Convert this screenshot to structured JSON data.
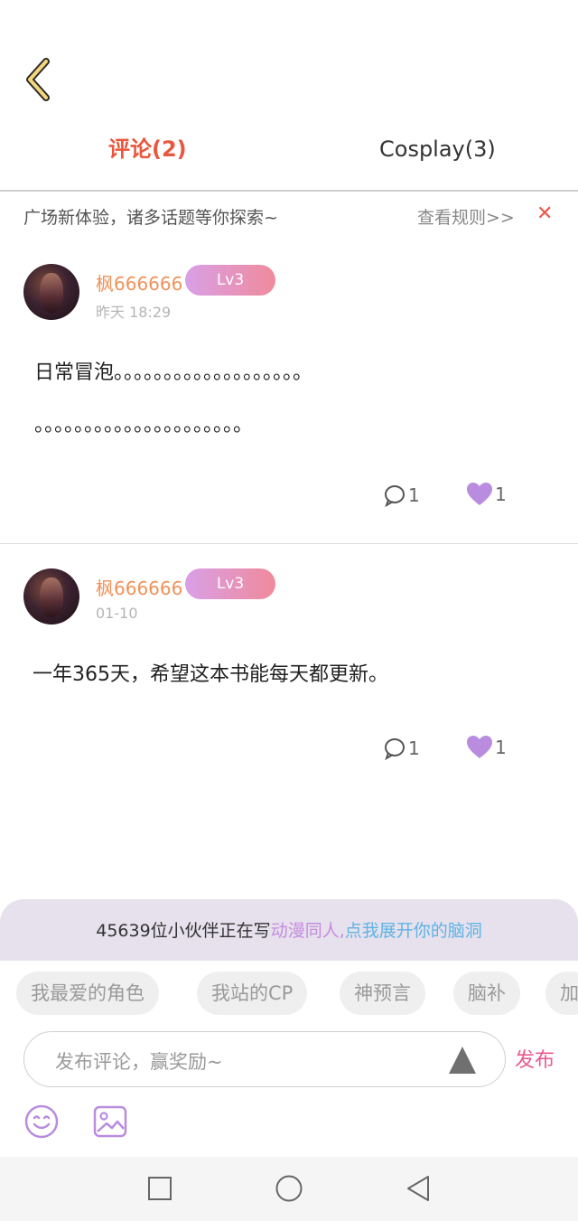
{
  "header": {
    "back_icon": "chevron-left-icon",
    "tabs": [
      {
        "label": "评论(2)",
        "active": true
      },
      {
        "label": "Cosplay(3)",
        "active": false
      }
    ],
    "accent_color": "#e8573e"
  },
  "notice": {
    "text": "广场新体验，诸多话题等你探索~",
    "rules_link": "查看规则>>",
    "close_icon": "close-icon"
  },
  "comments": [
    {
      "username": "枫666666",
      "level": "Lv3",
      "time": "昨天 18:29",
      "body_line1": "日常冒泡。。。。。。。。。。。。。。。。。。。",
      "body_line2": "。。。。。。。。。。。。。。。。。。。。。",
      "reply_count": "1",
      "like_count": "1"
    },
    {
      "username": "枫666666",
      "level": "Lv3",
      "time": "01-10",
      "body_line1": "一年365天，希望这本书能每天都更新。",
      "reply_count": "1",
      "like_count": "1"
    }
  ],
  "composer": {
    "banner_prefix": "45639位小伙伴正在写",
    "banner_highlight1": "动漫同人,",
    "banner_highlight2": "点我展开你的脑洞",
    "chips": [
      "我最爱的角色",
      "我站的CP",
      "神预言",
      "脑补",
      "加"
    ],
    "input_placeholder": "发布评论，赢奖励~",
    "publish_label": "发布",
    "tool_icons": [
      "emoji-icon",
      "image-icon"
    ]
  },
  "nav": {
    "icons": [
      "recent-apps-icon",
      "home-icon",
      "back-triangle-icon"
    ]
  }
}
